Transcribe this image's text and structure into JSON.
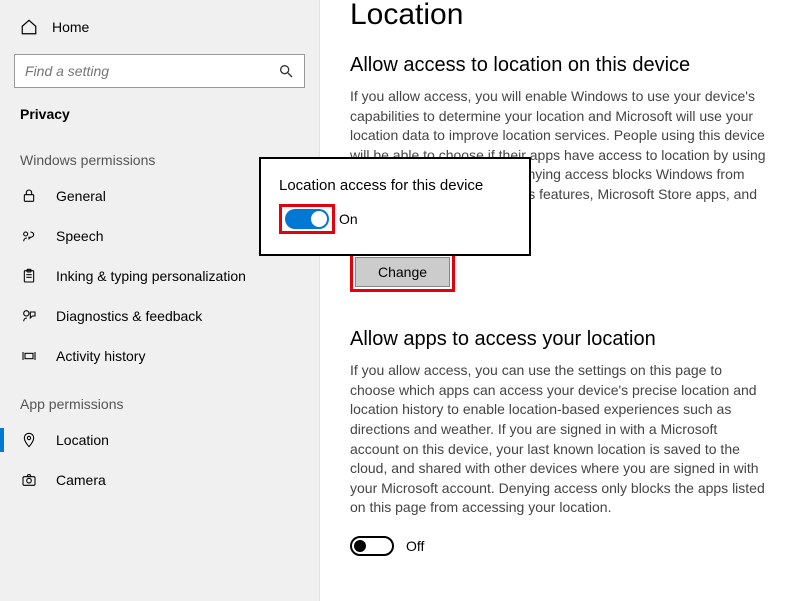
{
  "sidebar": {
    "home": "Home",
    "search_placeholder": "Find a setting",
    "category": "Privacy",
    "group1": "Windows permissions",
    "items1": [
      {
        "label": "General"
      },
      {
        "label": "Speech"
      },
      {
        "label": "Inking & typing personalization"
      },
      {
        "label": "Diagnostics & feedback"
      },
      {
        "label": "Activity history"
      }
    ],
    "group2": "App permissions",
    "items2": [
      {
        "label": "Location"
      },
      {
        "label": "Camera"
      }
    ]
  },
  "main": {
    "title": "Location",
    "section1_title": "Allow access to location on this device",
    "section1_body": "If you allow access, you will enable Windows to use your device's capabilities to determine your location and Microsoft will use your location data to improve location services. People using this device will be able to choose if their apps have access to location by using the settings on this page. Denying access blocks Windows from providing location to Windows features, Microsoft Store apps, and most desktop apps.",
    "change_button": "Change",
    "section2_title": "Allow apps to access your location",
    "section2_body": "If you allow access, you can use the settings on this page to choose which apps can access your device's precise location and location history to enable location-based experiences such as directions and weather. If you are signed in with a Microsoft account on this device, your last known location is saved to the cloud, and shared with other devices where you are signed in with your Microsoft account. Denying access only blocks the apps listed on this page from accessing your location.",
    "toggle_off_label": "Off"
  },
  "popup": {
    "title": "Location access for this device",
    "state": "On"
  }
}
